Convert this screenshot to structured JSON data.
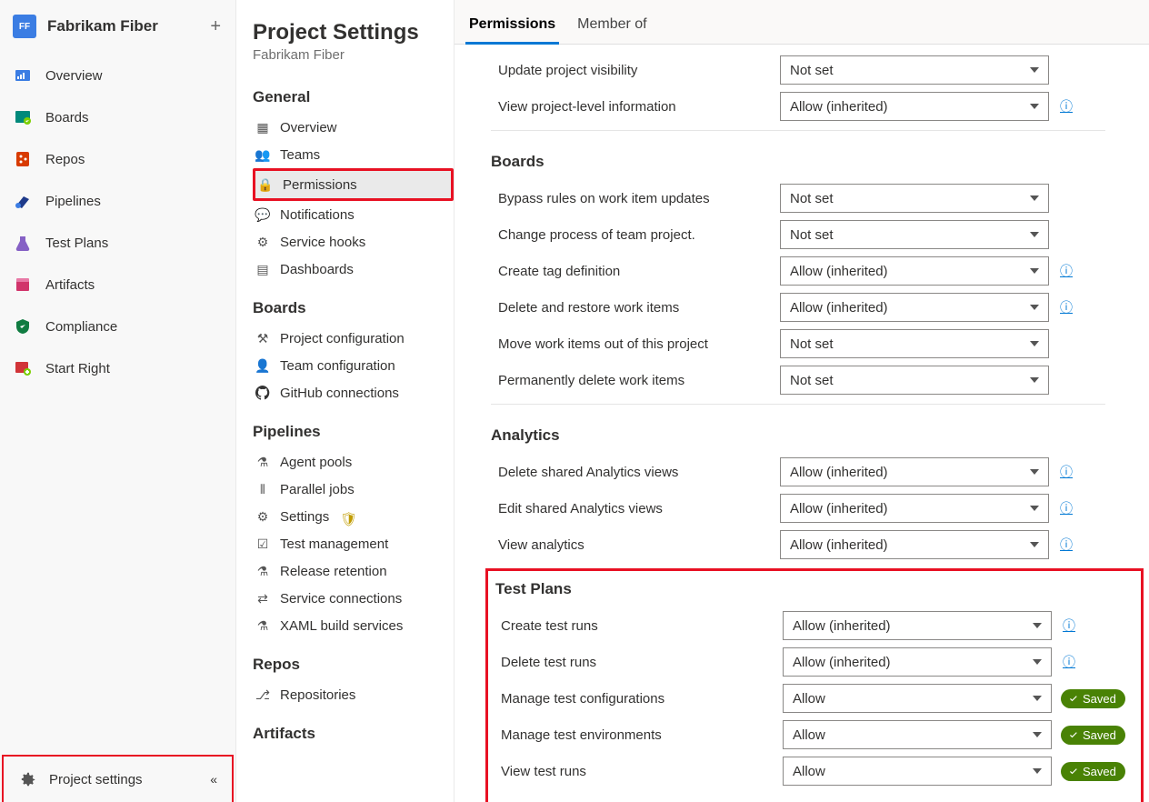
{
  "project": {
    "name": "Fabrikam Fiber",
    "logo_text": "FF"
  },
  "nav": [
    {
      "id": "overview",
      "label": "Overview"
    },
    {
      "id": "boards",
      "label": "Boards"
    },
    {
      "id": "repos",
      "label": "Repos"
    },
    {
      "id": "pipelines",
      "label": "Pipelines"
    },
    {
      "id": "test-plans",
      "label": "Test Plans"
    },
    {
      "id": "artifacts",
      "label": "Artifacts"
    },
    {
      "id": "compliance",
      "label": "Compliance"
    },
    {
      "id": "start-right",
      "label": "Start Right"
    }
  ],
  "footer": {
    "project_settings": "Project settings"
  },
  "settings": {
    "title": "Project Settings",
    "subtitle": "Fabrikam Fiber",
    "groups": {
      "general": {
        "label": "General",
        "items": [
          "Overview",
          "Teams",
          "Permissions",
          "Notifications",
          "Service hooks",
          "Dashboards"
        ]
      },
      "boards": {
        "label": "Boards",
        "items": [
          "Project configuration",
          "Team configuration",
          "GitHub connections"
        ]
      },
      "pipelines": {
        "label": "Pipelines",
        "items": [
          "Agent pools",
          "Parallel jobs",
          "Settings",
          "Test management",
          "Release retention",
          "Service connections",
          "XAML build services"
        ]
      },
      "repos": {
        "label": "Repos",
        "items": [
          "Repositories"
        ]
      },
      "artifacts": {
        "label": "Artifacts"
      }
    }
  },
  "tabs": {
    "permissions": "Permissions",
    "member_of": "Member of"
  },
  "perm_truncated": {
    "label": "",
    "value": "Not set"
  },
  "permissions_top": [
    {
      "label": "Update project visibility",
      "value": "Not set",
      "info": false
    },
    {
      "label": "View project-level information",
      "value": "Allow (inherited)",
      "info": true
    }
  ],
  "perm_boards": {
    "heading": "Boards",
    "rows": [
      {
        "label": "Bypass rules on work item updates",
        "value": "Not set",
        "info": false
      },
      {
        "label": "Change process of team project.",
        "value": "Not set",
        "info": false
      },
      {
        "label": "Create tag definition",
        "value": "Allow (inherited)",
        "info": true
      },
      {
        "label": "Delete and restore work items",
        "value": "Allow (inherited)",
        "info": true
      },
      {
        "label": "Move work items out of this project",
        "value": "Not set",
        "info": false
      },
      {
        "label": "Permanently delete work items",
        "value": "Not set",
        "info": false
      }
    ]
  },
  "perm_analytics": {
    "heading": "Analytics",
    "rows": [
      {
        "label": "Delete shared Analytics views",
        "value": "Allow (inherited)",
        "info": true
      },
      {
        "label": "Edit shared Analytics views",
        "value": "Allow (inherited)",
        "info": true
      },
      {
        "label": "View analytics",
        "value": "Allow (inherited)",
        "info": true
      }
    ]
  },
  "perm_testplans": {
    "heading": "Test Plans",
    "rows": [
      {
        "label": "Create test runs",
        "value": "Allow (inherited)",
        "info": true,
        "saved": false
      },
      {
        "label": "Delete test runs",
        "value": "Allow (inherited)",
        "info": true,
        "saved": false
      },
      {
        "label": "Manage test configurations",
        "value": "Allow",
        "info": false,
        "saved": true
      },
      {
        "label": "Manage test environments",
        "value": "Allow",
        "info": false,
        "saved": true
      },
      {
        "label": "View test runs",
        "value": "Allow",
        "info": false,
        "saved": true
      }
    ]
  },
  "saved_label": "Saved",
  "info_glyph": "ⓘ"
}
